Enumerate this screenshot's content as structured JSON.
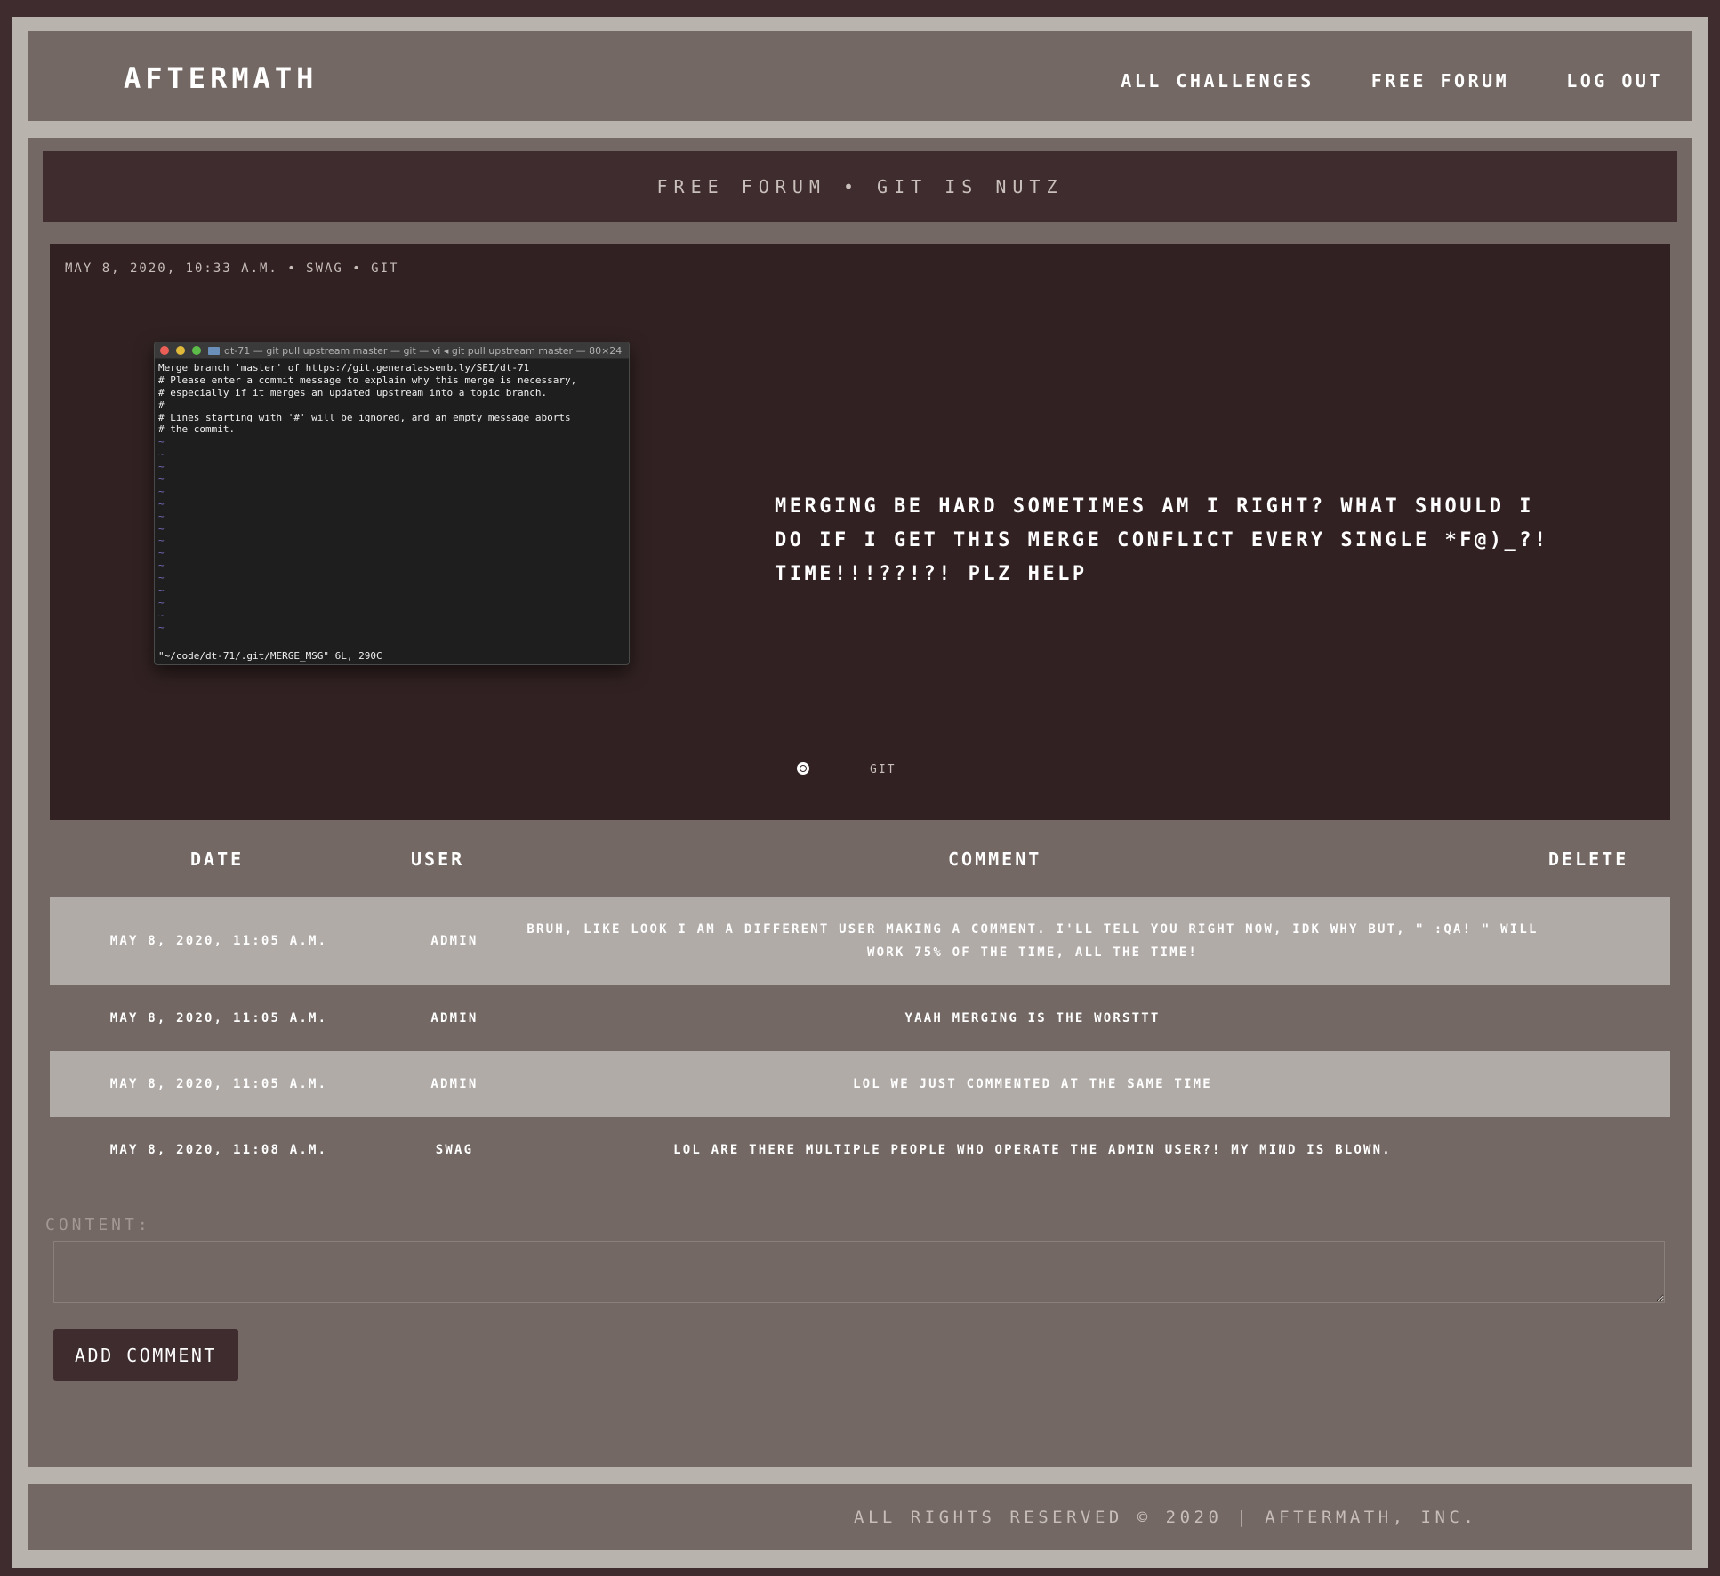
{
  "header": {
    "logo": "AFTERMATH",
    "nav": [
      {
        "label": "ALL CHALLENGES"
      },
      {
        "label": "FREE FORUM"
      },
      {
        "label": "LOG OUT"
      }
    ]
  },
  "page": {
    "title": "FREE FORUM • GIT IS NUTZ"
  },
  "post": {
    "meta": "MAY 8, 2020, 10:33 A.M. • SWAG • GIT",
    "body": "MERGING BE HARD SOMETIMES AM I RIGHT? WHAT SHOULD I DO IF I GET THIS MERGE CONFLICT EVERY SINGLE *F@)_?! TIME!!!??!?! PLZ HELP",
    "tag": "GIT",
    "screenshot": {
      "title": "dt-71 — git pull upstream master — git — vi ◂ git pull upstream master — 80×24",
      "lines": [
        "Merge branch 'master' of https://git.generalassemb.ly/SEI/dt-71",
        "# Please enter a commit message to explain why this merge is necessary,",
        "# especially if it merges an updated upstream into a topic branch.",
        "#",
        "# Lines starting with '#' will be ignored, and an empty message aborts",
        "# the commit."
      ],
      "tilde": "~",
      "status": "\"~/code/dt-71/.git/MERGE_MSG\" 6L, 290C"
    }
  },
  "comments": {
    "headers": {
      "date": "DATE",
      "user": "USER",
      "comment": "COMMENT",
      "delete": "DELETE"
    },
    "rows": [
      {
        "date": "MAY 8, 2020, 11:05 A.M.",
        "user": "ADMIN",
        "comment": "BRUH, LIKE LOOK I AM A DIFFERENT USER MAKING A COMMENT. I'LL TELL YOU RIGHT NOW, IDK WHY BUT, \" :QA! \" WILL WORK 75% OF THE TIME, ALL THE TIME!"
      },
      {
        "date": "MAY 8, 2020, 11:05 A.M.",
        "user": "ADMIN",
        "comment": "YAAH MERGING IS THE WORSTTT"
      },
      {
        "date": "MAY 8, 2020, 11:05 A.M.",
        "user": "ADMIN",
        "comment": "LOL WE JUST COMMENTED AT THE SAME TIME"
      },
      {
        "date": "MAY 8, 2020, 11:08 A.M.",
        "user": "SWAG",
        "comment": "LOL ARE THERE MULTIPLE PEOPLE WHO OPERATE THE ADMIN USER?! MY MIND IS BLOWN."
      }
    ]
  },
  "form": {
    "content_label": "CONTENT:",
    "content_value": "",
    "submit_label": "ADD COMMENT"
  },
  "footer": {
    "text": "ALL RIGHTS RESERVED © 2020 | AFTERMATH, INC."
  },
  "colors": {
    "page_bg": "#3e2c2e",
    "frame": "#b8b4ad",
    "panel": "#736863",
    "post_bg": "#312122",
    "row_shade": "#b1aba8"
  }
}
